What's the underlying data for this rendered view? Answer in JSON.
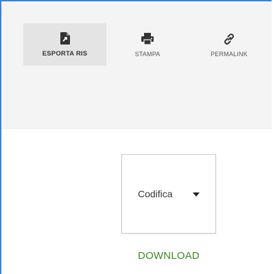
{
  "toolbar": {
    "actions": [
      {
        "label": "ESPORTA RIS",
        "icon": "file-export-icon",
        "active": true
      },
      {
        "label": "STAMPA",
        "icon": "printer-icon",
        "active": false
      },
      {
        "label": "PERMALINK",
        "icon": "link-icon",
        "active": false
      }
    ]
  },
  "export": {
    "encoding_select": {
      "value": "Codifica",
      "icon": "caret-down-icon"
    },
    "download_label": "DOWNLOAD"
  },
  "colors": {
    "accent_border": "#3f7fd4",
    "download_text": "#3a8a1f",
    "toolbar_bg": "#f4f4f4",
    "active_bg": "#e4e4e4"
  }
}
